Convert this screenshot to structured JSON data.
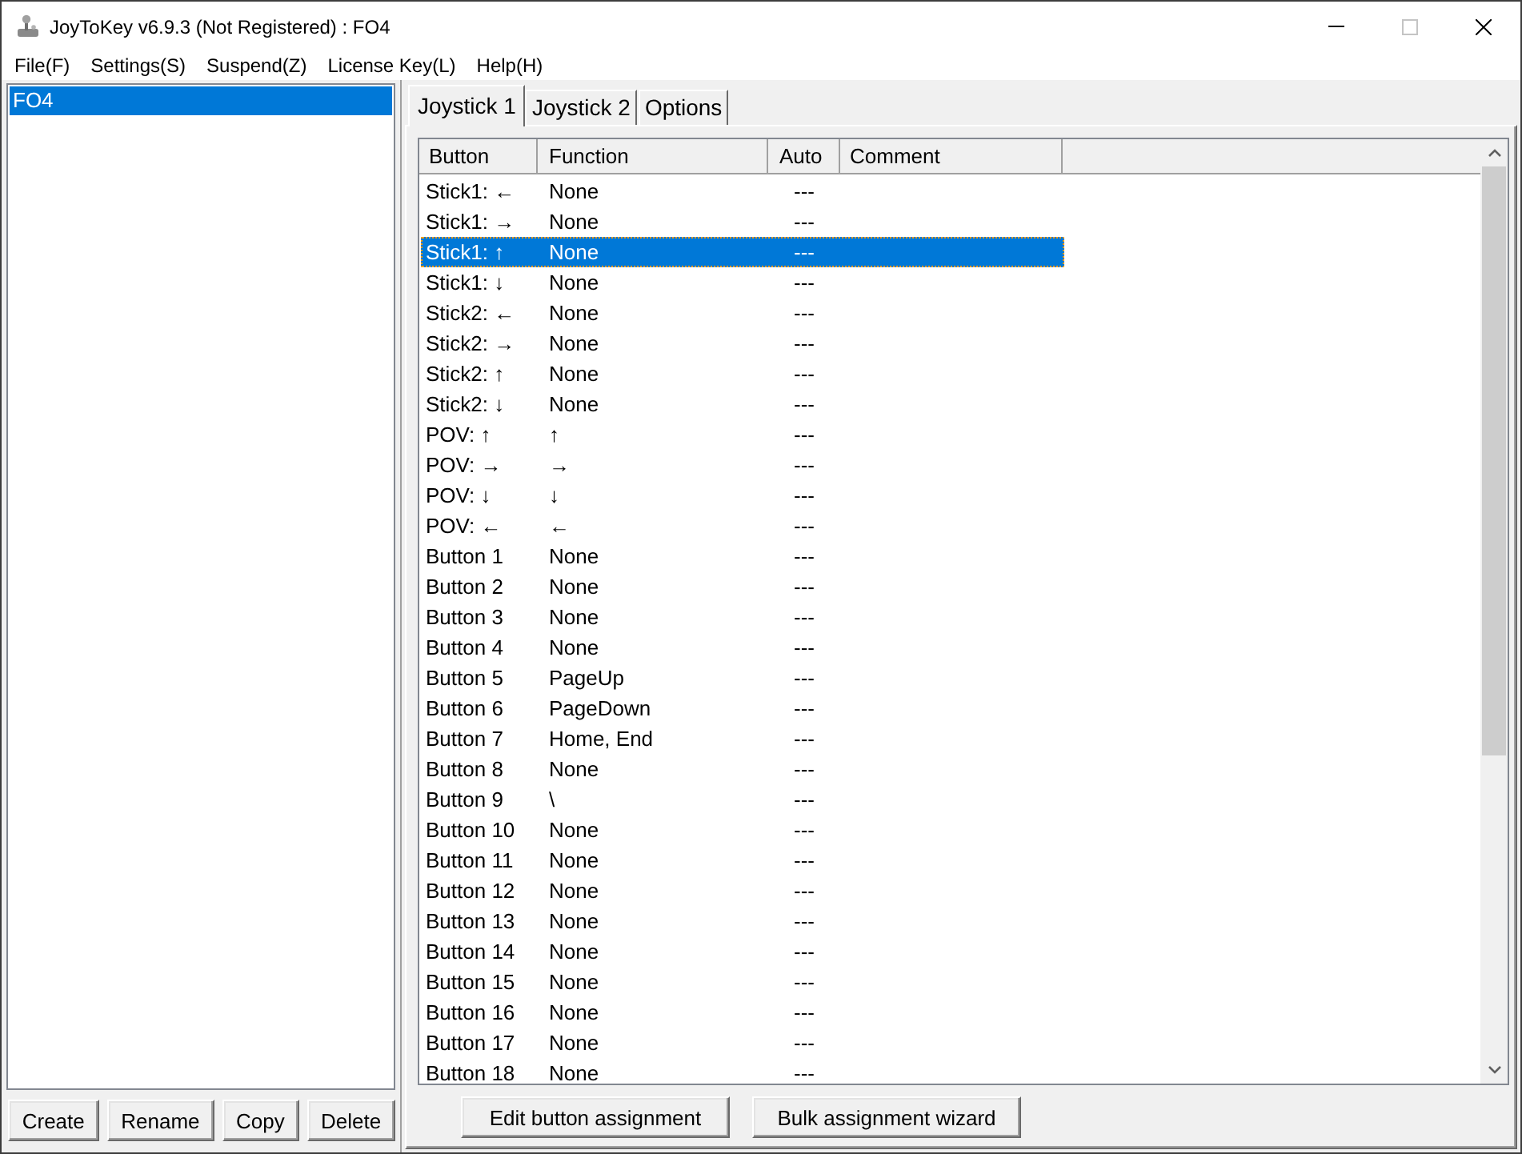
{
  "window": {
    "title": "JoyToKey v6.9.3 (Not Registered) : FO4"
  },
  "menu": [
    "File(F)",
    "Settings(S)",
    "Suspend(Z)",
    "License Key(L)",
    "Help(H)"
  ],
  "profiles": {
    "items": [
      {
        "label": "FO4",
        "selected": true
      }
    ],
    "buttons": [
      "Create",
      "Rename",
      "Copy",
      "Delete"
    ]
  },
  "tabs": [
    {
      "label": "Joystick 1",
      "selected": true
    },
    {
      "label": "Joystick 2",
      "selected": false
    },
    {
      "label": "Options",
      "selected": false
    }
  ],
  "table": {
    "columns": [
      "Button",
      "Function",
      "Auto",
      "Comment"
    ],
    "rows": [
      {
        "button": "Stick1: ←",
        "function": "None",
        "auto": "---",
        "selected": false
      },
      {
        "button": "Stick1: →",
        "function": "None",
        "auto": "---",
        "selected": false
      },
      {
        "button": "Stick1: ↑",
        "function": "None",
        "auto": "---",
        "selected": true
      },
      {
        "button": "Stick1: ↓",
        "function": "None",
        "auto": "---",
        "selected": false
      },
      {
        "button": "Stick2: ←",
        "function": "None",
        "auto": "---",
        "selected": false
      },
      {
        "button": "Stick2: →",
        "function": "None",
        "auto": "---",
        "selected": false
      },
      {
        "button": "Stick2: ↑",
        "function": "None",
        "auto": "---",
        "selected": false
      },
      {
        "button": "Stick2: ↓",
        "function": "None",
        "auto": "---",
        "selected": false
      },
      {
        "button": "POV: ↑",
        "function": "↑",
        "auto": "---",
        "selected": false
      },
      {
        "button": "POV: →",
        "function": "→",
        "auto": "---",
        "selected": false
      },
      {
        "button": "POV: ↓",
        "function": "↓",
        "auto": "---",
        "selected": false
      },
      {
        "button": "POV: ←",
        "function": "←",
        "auto": "---",
        "selected": false
      },
      {
        "button": "Button 1",
        "function": "None",
        "auto": "---",
        "selected": false
      },
      {
        "button": "Button 2",
        "function": "None",
        "auto": "---",
        "selected": false
      },
      {
        "button": "Button 3",
        "function": "None",
        "auto": "---",
        "selected": false
      },
      {
        "button": "Button 4",
        "function": "None",
        "auto": "---",
        "selected": false
      },
      {
        "button": "Button 5",
        "function": "PageUp",
        "auto": "---",
        "selected": false
      },
      {
        "button": "Button 6",
        "function": "PageDown",
        "auto": "---",
        "selected": false
      },
      {
        "button": "Button 7",
        "function": "Home, End",
        "auto": "---",
        "selected": false
      },
      {
        "button": "Button 8",
        "function": "None",
        "auto": "---",
        "selected": false
      },
      {
        "button": "Button 9",
        "function": "\\",
        "auto": "---",
        "selected": false
      },
      {
        "button": "Button 10",
        "function": "None",
        "auto": "---",
        "selected": false
      },
      {
        "button": "Button 11",
        "function": "None",
        "auto": "---",
        "selected": false
      },
      {
        "button": "Button 12",
        "function": "None",
        "auto": "---",
        "selected": false
      },
      {
        "button": "Button 13",
        "function": "None",
        "auto": "---",
        "selected": false
      },
      {
        "button": "Button 14",
        "function": "None",
        "auto": "---",
        "selected": false
      },
      {
        "button": "Button 15",
        "function": "None",
        "auto": "---",
        "selected": false
      },
      {
        "button": "Button 16",
        "function": "None",
        "auto": "---",
        "selected": false
      },
      {
        "button": "Button 17",
        "function": "None",
        "auto": "---",
        "selected": false
      },
      {
        "button": "Button 18",
        "function": "None",
        "auto": "---",
        "selected": false
      }
    ]
  },
  "buttons": [
    "Edit button assignment",
    "Bulk assignment wizard"
  ]
}
